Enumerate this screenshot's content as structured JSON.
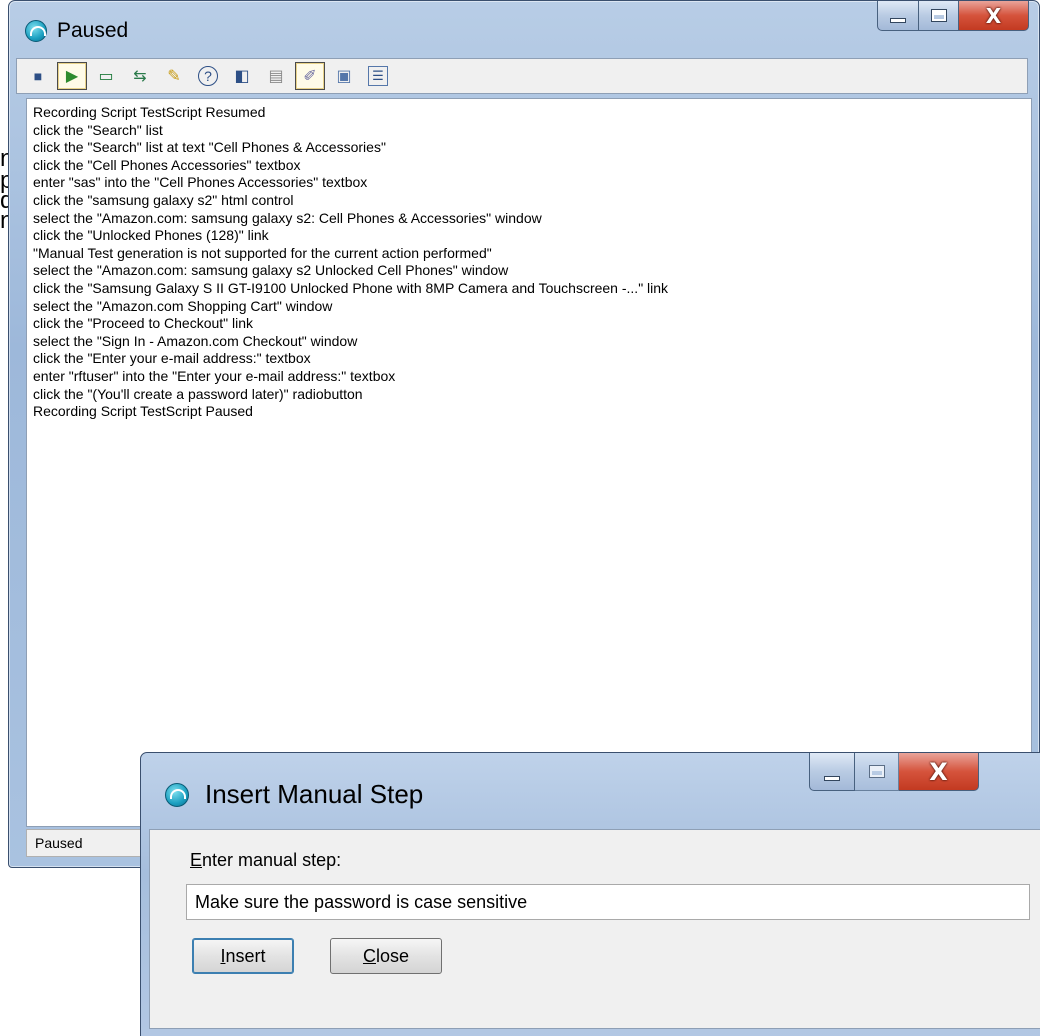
{
  "background": {
    "fragments": [
      "n",
      "p",
      "d",
      "n"
    ]
  },
  "main_window": {
    "title": "Paused",
    "toolbar": {
      "buttons": [
        {
          "name": "stop-recording",
          "glyph": "■"
        },
        {
          "name": "resume-recording",
          "glyph": "▶"
        },
        {
          "name": "insert-verification",
          "glyph": "▭"
        },
        {
          "name": "insert-data-driven",
          "glyph": "⇆"
        },
        {
          "name": "insert-script-support",
          "glyph": "✎"
        },
        {
          "name": "help",
          "glyph": "?"
        },
        {
          "name": "toggle-panel",
          "glyph": "◧"
        },
        {
          "name": "copy",
          "glyph": "▤"
        },
        {
          "name": "insert-manual-step",
          "glyph": "✐"
        },
        {
          "name": "save",
          "glyph": "▣"
        },
        {
          "name": "options",
          "glyph": "☰"
        }
      ]
    },
    "log_lines": [
      "Recording Script TestScript Resumed",
      "click the \"Search\" list",
      "click the \"Search\" list at text \"Cell Phones & Accessories\"",
      "click the \"Cell Phones  Accessories\" textbox",
      "enter \"sas\" into the \"Cell Phones  Accessories\" textbox",
      "click the \"samsung galaxy s2\" html control",
      "select the \"Amazon.com: samsung galaxy s2: Cell Phones & Accessories\" window",
      "click the \"Unlocked Phones (128)\" link",
      "\"Manual Test generation is not supported for the current action performed\"",
      "select the \"Amazon.com: samsung galaxy s2 Unlocked Cell Phones\" window",
      "click the \"Samsung Galaxy S II GT-I9100 Unlocked Phone with 8MP Camera and Touchscreen -...\" link",
      "select the \"Amazon.com Shopping Cart\" window",
      "click the \"Proceed to Checkout\" link",
      "select the \"Sign In - Amazon.com Checkout\" window",
      "click the \"Enter your e-mail address:\" textbox",
      "enter \"rftuser\" into the \"Enter your e-mail address:\" textbox",
      "click the \"(You'll create a password later)\" radiobutton",
      "Recording Script TestScript Paused"
    ],
    "status": "Paused"
  },
  "dialog": {
    "title": "Insert Manual Step",
    "label_prefix": "E",
    "label_rest": "nter manual step:",
    "input_value": "Make sure the password is case sensitive",
    "insert_prefix": "I",
    "insert_rest": "nsert",
    "close_prefix": "C",
    "close_rest": "lose"
  }
}
